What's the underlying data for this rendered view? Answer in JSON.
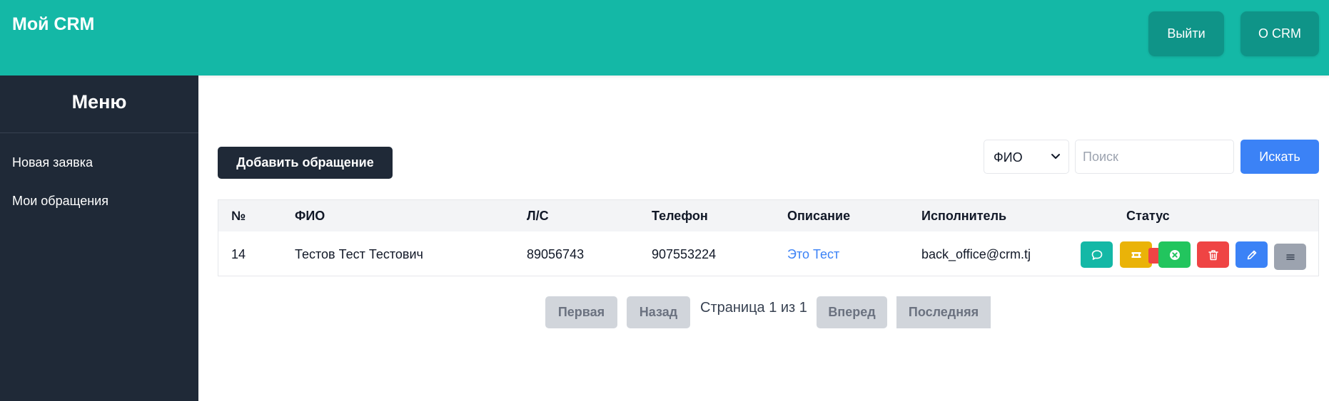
{
  "header": {
    "brand": "Мой CRM",
    "logout_label": "Выйти",
    "about_label": "О CRM",
    "color": "#14b8a6"
  },
  "sidebar": {
    "title": "Меню",
    "items": [
      {
        "label": "Новая заявка"
      },
      {
        "label": "Мои обращения"
      }
    ]
  },
  "toolbar": {
    "add_label": "Добавить обращение",
    "filter_selected": "ФИО",
    "search_placeholder": "Поиск",
    "search_value": "",
    "search_button": "Искать"
  },
  "table": {
    "columns": [
      "№",
      "ФИО",
      "Л/С",
      "Телефон",
      "Описание",
      "Исполнитель",
      "Статус"
    ],
    "rows": [
      {
        "number": "14",
        "fio": "Тестов Тест Тестович",
        "account": "89056743",
        "phone": "907553224",
        "description": "Это Тест",
        "assignee": "back_office@crm.tj",
        "actions": [
          "chat-icon",
          "ticket-icon",
          "cancel-icon",
          "trash-icon",
          "pencil-icon",
          "menu-icon"
        ]
      }
    ]
  },
  "pagination": {
    "first": "Первая",
    "prev": "Назад",
    "info": "Страница 1 из 1",
    "next": "Вперед",
    "last": "Последняя"
  },
  "colors": {
    "teal": "#14b8a6",
    "dark": "#1f2937",
    "blue": "#3b82f6",
    "yellow": "#eab308",
    "green": "#22c55e",
    "red": "#ef4444",
    "gray": "#9ca3af"
  }
}
